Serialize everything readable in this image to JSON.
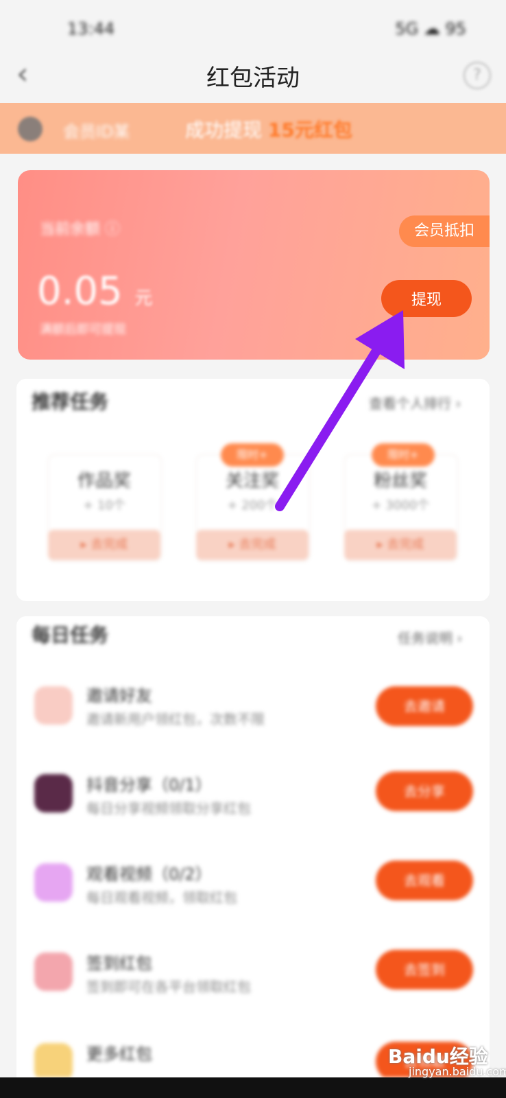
{
  "status_bar": {
    "time": "13:44",
    "indicators": "5G ☁ 95"
  },
  "nav": {
    "back_icon": "‹",
    "title": "红包活动",
    "help_icon": "?"
  },
  "notice": {
    "user": "会员ID某",
    "text_prefix": "成功提现",
    "highlight": "15元红包"
  },
  "balance": {
    "label": "当前余额 ⓘ",
    "amount": "0.05",
    "unit": "元",
    "note": "满额后即可提现",
    "vip_tag": "会员抵扣",
    "withdraw_button": "提现"
  },
  "recommended": {
    "title": "推荐任务",
    "more": "查看个人排行 ›",
    "cards": [
      {
        "name": "作品奖",
        "sub": "+ 10个",
        "button": "▸ 去完成",
        "badge": ""
      },
      {
        "name": "关注奖",
        "sub": "+ 200个",
        "button": "▸ 去完成",
        "badge": "限时+"
      },
      {
        "name": "粉丝奖",
        "sub": "+ 3000个",
        "button": "▸ 去完成",
        "badge": "限时+"
      }
    ]
  },
  "daily": {
    "title": "每日任务",
    "more": "任务说明 ›",
    "tasks": [
      {
        "icon_color": "#f9ccc4",
        "title": "邀请好友",
        "desc": "邀请新用户领红包，次数不限",
        "button": "去邀请"
      },
      {
        "icon_color": "#5a2a48",
        "title": "抖音分享（0/1）",
        "desc": "每日分享视频领取分享红包",
        "button": "去分享"
      },
      {
        "icon_color": "#e6a6f2",
        "title": "观看视频（0/2）",
        "desc": "每日观看视频，领取红包",
        "button": "去观看"
      },
      {
        "icon_color": "#f3a6ad",
        "title": "签到红包",
        "desc": "签到即可在各平台领取红包",
        "button": "去签到"
      },
      {
        "icon_color": "#f7d27a",
        "title": "更多红包",
        "desc": "",
        "button": "去领取"
      }
    ]
  },
  "watermark": {
    "brand": "Baidu经验",
    "url": "jingyan.baidu.com"
  },
  "colors": {
    "accent": "#f4561c",
    "annotation_arrow": "#8a1cf0"
  }
}
